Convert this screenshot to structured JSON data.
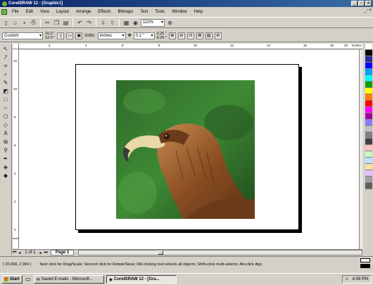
{
  "window": {
    "title": "CorelDRAW 12 - [Graphic1]"
  },
  "menu": [
    "File",
    "Edit",
    "View",
    "Layout",
    "Arrange",
    "Effects",
    "Bitmaps",
    "Text",
    "Tools",
    "Window",
    "Help"
  ],
  "toolbar": {
    "zoom": "110%"
  },
  "property_bar": {
    "paper_preset": "Custom",
    "page_width": "16.0 \"",
    "page_height": "12.0 \"",
    "units_label": "Units:",
    "units_value": "inches",
    "nudge": "0.1 \"",
    "dup_x": "0.25 \"",
    "dup_y": "0.25 \""
  },
  "ruler": {
    "units": "inches",
    "top_ticks": [
      "2",
      "4",
      "6",
      "8",
      "10",
      "12",
      "14",
      "16",
      "18",
      "20"
    ],
    "left_ticks": [
      "12",
      "10",
      "8",
      "6",
      "4",
      "2",
      "0"
    ],
    "left_units": "inches"
  },
  "page_nav": {
    "counter": "1 of 1",
    "tab": "Page 1"
  },
  "status": {
    "coords": "( 20.658, 2.994 )",
    "hint": "Next click for Drag/Scale; Second click for Rotate/Skew; Dbl-clicking tool selects all objects; Shift+click multi-selects; Alt+click digs"
  },
  "taskbar": {
    "start": "Start",
    "tasks": [
      "Saved E-mails - Microsoft...",
      "CorelDRAW 12 - [Gra..."
    ],
    "clock": "4:08 PM",
    "tray_arrow": "«"
  },
  "palette_colors": [
    "#ffffff",
    "#000000",
    "#2a2a9a",
    "#0000ff",
    "#00a0ff",
    "#00ffff",
    "#00a000",
    "#ffff00",
    "#ff8000",
    "#ff0000",
    "#ff00ff",
    "#a000a0",
    "#8080ff",
    "#c0c0c0",
    "#808080",
    "#404040",
    "#ffc0c0",
    "#c0ffc0",
    "#c0e0ff",
    "#ffe0a0",
    "#e0c0ff",
    "#a0a0a0",
    "#606060"
  ]
}
